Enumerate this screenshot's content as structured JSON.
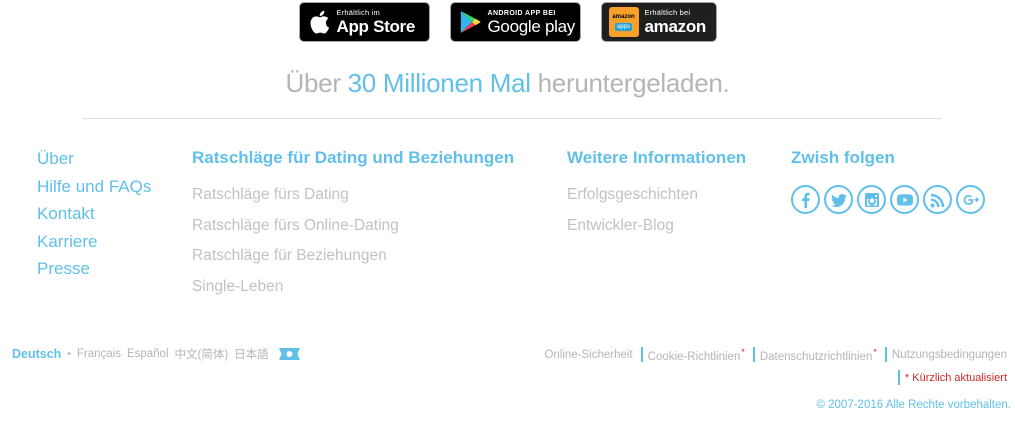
{
  "stores": {
    "apple": {
      "small": "Erhältlich im",
      "big": "App Store",
      "icon": "apple-icon"
    },
    "google": {
      "small": "ANDROID APP BEI",
      "big": "Google play",
      "icon": "google-play-icon"
    },
    "amazon": {
      "logo_top": "amazon",
      "logo_apps": "apps",
      "small": "Erhältlich bei",
      "big": "amazon",
      "icon": "amazon-apps-icon"
    }
  },
  "headline": {
    "pre": "Über ",
    "highlight": "30 Millionen Mal",
    "post": " heruntergeladen."
  },
  "footer": {
    "col1": {
      "links": [
        "Über",
        "Hilfe und FAQs",
        "Kontakt",
        "Karriere",
        "Presse"
      ]
    },
    "col2": {
      "title": "Ratschläge für Dating und Beziehungen",
      "links": [
        "Ratschläge fürs Dating",
        "Ratschläge fürs Online-Dating",
        "Ratschläge für Beziehungen",
        "Single-Leben"
      ]
    },
    "col3": {
      "title": "Weitere Informationen",
      "links": [
        "Erfolgsgeschichten",
        "Entwickler-Blog"
      ]
    },
    "col4": {
      "title": "Zwish folgen",
      "social": [
        "facebook-icon",
        "twitter-icon",
        "instagram-icon",
        "youtube-icon",
        "rss-icon",
        "google-plus-icon"
      ]
    }
  },
  "languages": {
    "current": "Deutsch",
    "others": [
      "Français",
      "Español",
      "中文(简体)",
      "日本語"
    ],
    "more_icon": "more-languages-icon"
  },
  "legal": {
    "links": [
      "Online-Sicherheit",
      "Cookie-Richtlinien",
      "Datenschutzrichtlinien",
      "Nutzungsbedingungen"
    ],
    "star": "*",
    "updated": "* Kürzlich aktualisiert",
    "copyright": "© 2007-2016  Alle Rechte vorbehalten."
  },
  "colors": {
    "accent": "#61c0ea",
    "muted": "#b5b5b5",
    "alert": "#cc2b2b"
  }
}
